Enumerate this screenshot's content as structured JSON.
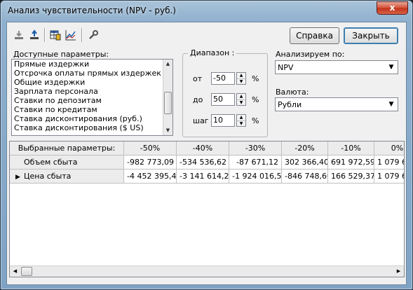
{
  "window": {
    "title": "Анализ чувствительности (NPV - руб.)",
    "close_glyph": "x"
  },
  "toolbar": {
    "icons": [
      "import-icon",
      "export-icon",
      "table-icon",
      "chart-icon",
      "wrench-icon"
    ],
    "help_label": "Справка",
    "close_label": "Закрыть"
  },
  "params": {
    "label": "Доступные параметры:",
    "items": [
      "Прямые издержки",
      "Отсрочка оплаты прямых издержек",
      "Общие издержки",
      "Зарплата персонала",
      "Ставки по депозитам",
      "Ставки по кредитам",
      "Ставка дисконтирования (руб.)",
      "Ставка дисконтирования ($ US)"
    ]
  },
  "range": {
    "title": "Диапазон :",
    "from_label": "от",
    "from_value": "-50",
    "to_label": "до",
    "to_value": "50",
    "step_label": "шаг",
    "step_value": "10",
    "unit": "%"
  },
  "analyze": {
    "label": "Анализируем по:",
    "value": "NPV"
  },
  "currency": {
    "label": "Валюта:",
    "value": "Рубли"
  },
  "grid": {
    "header_label": "Выбранные параметры:",
    "columns": [
      "-50%",
      "-40%",
      "-30%",
      "-20%",
      "-10%",
      "0%"
    ],
    "rows": [
      {
        "marker": "",
        "label": "Объем сбыта",
        "values": [
          "-982 773,09",
          "-534 536,62",
          "-87 671,12",
          "302 366,40",
          "691 972,59",
          "1 079 6"
        ]
      },
      {
        "marker": "▶",
        "label": "Цена сбыта",
        "values": [
          "-4 452 395,41",
          "-3 141 614,24",
          "-1 924 016,50",
          "-846 748,60",
          "166 529,37",
          "1 079 6"
        ]
      }
    ]
  }
}
